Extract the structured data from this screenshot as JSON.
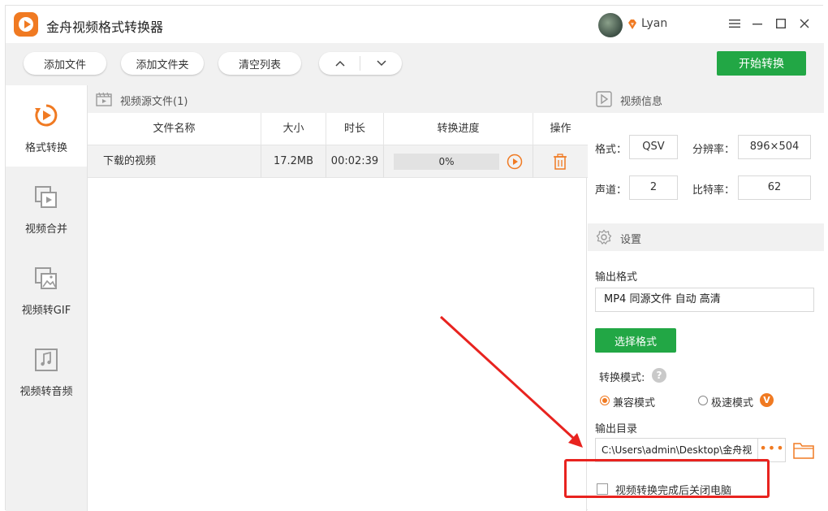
{
  "app": {
    "title": "金舟视频格式转换器",
    "user_name": "Lyan",
    "window_controls": [
      "menu-icon",
      "minimize-icon",
      "maximize-icon",
      "close-icon"
    ]
  },
  "toolbar": {
    "add_file": "添加文件",
    "add_folder": "添加文件夹",
    "clear_list": "清空列表",
    "move_up_icon": "chevron-up-icon",
    "move_down_icon": "chevron-down-icon",
    "start": "开始转换"
  },
  "sidebar": {
    "items": [
      {
        "label": "格式转换",
        "icon": "format-convert-icon",
        "active": true
      },
      {
        "label": "视频合并",
        "icon": "video-merge-icon",
        "active": false
      },
      {
        "label": "视频转GIF",
        "icon": "gif-icon",
        "active": false
      },
      {
        "label": "视频转音频",
        "icon": "audio-icon",
        "active": false
      }
    ]
  },
  "file_panel": {
    "title": "视频源文件(1)",
    "columns": [
      "文件名称",
      "大小",
      "时长",
      "转换进度",
      "操作"
    ],
    "rows": [
      {
        "name": "下载的视频",
        "size": "17.2MB",
        "duration": "00:02:39",
        "progress": "0%"
      }
    ]
  },
  "video_info": {
    "title": "视频信息",
    "format_label": "格式：",
    "format": "QSV",
    "resolution_label": "分辨率：",
    "resolution": "896×504",
    "channels_label": "声道：",
    "channels": "2",
    "bitrate_label": "比特率：",
    "bitrate": "62"
  },
  "settings": {
    "title": "设置",
    "output_format_label": "输出格式",
    "output_format": "MP4 同源文件 自动 高清",
    "choose_format": "选择格式",
    "mode_label": "转换模式:",
    "mode_compat": "兼容模式",
    "mode_fast": "极速模式",
    "mode_selected": "兼容模式",
    "vip_badge": "V",
    "output_dir_label": "输出目录",
    "output_dir": "C:\\Users\\admin\\Desktop\\金舟视",
    "dir_more": "•••",
    "shutdown_label": "视频转换完成后关闭电脑",
    "shutdown_checked": false
  },
  "colors": {
    "accent_orange": "#f07a22",
    "start_green": "#22a745",
    "annotation_red": "#e8231f"
  }
}
